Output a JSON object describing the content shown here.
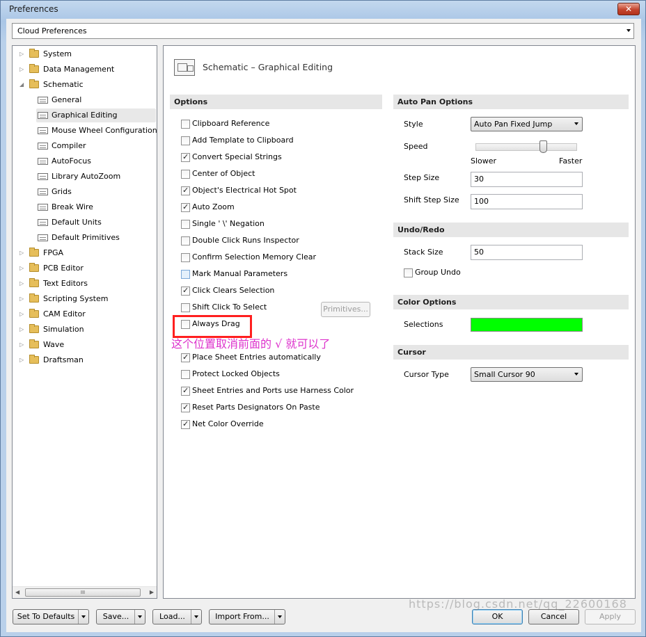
{
  "window": {
    "title": "Preferences",
    "close_label": "✕"
  },
  "category_select": {
    "value": "Cloud Preferences"
  },
  "tree": {
    "items": [
      {
        "label": "System",
        "level": 0,
        "kind": "folder",
        "expander": "closed"
      },
      {
        "label": "Data Management",
        "level": 0,
        "kind": "folder",
        "expander": "closed"
      },
      {
        "label": "Schematic",
        "level": 0,
        "kind": "folder-open",
        "expander": "open"
      },
      {
        "label": "General",
        "level": 1,
        "kind": "page"
      },
      {
        "label": "Graphical Editing",
        "level": 1,
        "kind": "page",
        "selected": true
      },
      {
        "label": "Mouse Wheel Configuration",
        "level": 1,
        "kind": "page"
      },
      {
        "label": "Compiler",
        "level": 1,
        "kind": "page"
      },
      {
        "label": "AutoFocus",
        "level": 1,
        "kind": "page"
      },
      {
        "label": "Library AutoZoom",
        "level": 1,
        "kind": "page"
      },
      {
        "label": "Grids",
        "level": 1,
        "kind": "page"
      },
      {
        "label": "Break Wire",
        "level": 1,
        "kind": "page"
      },
      {
        "label": "Default Units",
        "level": 1,
        "kind": "page"
      },
      {
        "label": "Default Primitives",
        "level": 1,
        "kind": "page"
      },
      {
        "label": "FPGA",
        "level": 0,
        "kind": "folder",
        "expander": "closed"
      },
      {
        "label": "PCB Editor",
        "level": 0,
        "kind": "folder",
        "expander": "closed"
      },
      {
        "label": "Text Editors",
        "level": 0,
        "kind": "folder",
        "expander": "closed"
      },
      {
        "label": "Scripting System",
        "level": 0,
        "kind": "folder",
        "expander": "closed"
      },
      {
        "label": "CAM Editor",
        "level": 0,
        "kind": "folder",
        "expander": "closed"
      },
      {
        "label": "Simulation",
        "level": 0,
        "kind": "folder",
        "expander": "closed"
      },
      {
        "label": "Wave",
        "level": 0,
        "kind": "folder",
        "expander": "closed"
      },
      {
        "label": "Draftsman",
        "level": 0,
        "kind": "folder",
        "expander": "closed"
      }
    ],
    "scroll_thumb_label": "III"
  },
  "panel": {
    "title": "Schematic – Graphical Editing"
  },
  "options": {
    "header": "Options",
    "items": [
      {
        "label": "Clipboard Reference",
        "checked": false
      },
      {
        "label": "Add Template to Clipboard",
        "checked": false
      },
      {
        "label": "Convert Special Strings",
        "checked": true
      },
      {
        "label": "Center of Object",
        "checked": false
      },
      {
        "label": "Object's Electrical Hot Spot",
        "checked": true
      },
      {
        "label": "Auto Zoom",
        "checked": true
      },
      {
        "label": "Single ' \\' Negation",
        "checked": false
      },
      {
        "label": "Double Click Runs Inspector",
        "checked": false
      },
      {
        "label": "Confirm Selection Memory Clear",
        "checked": false
      },
      {
        "label": "Mark Manual Parameters",
        "checked": false,
        "highlight": true
      },
      {
        "label": "Click Clears Selection",
        "checked": true
      },
      {
        "label": "Shift Click To Select",
        "checked": false
      },
      {
        "label": "Always Drag",
        "checked": false
      },
      {
        "label": "Place Sheet Entries automatically",
        "checked": true
      },
      {
        "label": "Protect Locked Objects",
        "checked": false
      },
      {
        "label": "Sheet Entries and Ports use Harness Color",
        "checked": true
      },
      {
        "label": "Reset Parts Designators On Paste",
        "checked": true
      },
      {
        "label": "Net Color Override",
        "checked": true
      }
    ],
    "primitives_button": "Primitives..."
  },
  "annotation": {
    "text": "这个位置取消前面的 √ 就可以了",
    "color": "#dd33cc",
    "box_color": "#ff1f1f"
  },
  "auto_pan": {
    "header": "Auto Pan Options",
    "style_label": "Style",
    "style_value": "Auto Pan Fixed Jump",
    "speed_label": "Speed",
    "speed_level": 0.68,
    "slower_label": "Slower",
    "faster_label": "Faster",
    "step_size_label": "Step Size",
    "step_size_value": "30",
    "shift_step_size_label": "Shift Step Size",
    "shift_step_size_value": "100"
  },
  "undo_redo": {
    "header": "Undo/Redo",
    "stack_size_label": "Stack Size",
    "stack_size_value": "50",
    "group_undo_label": "Group Undo",
    "group_undo_checked": false
  },
  "color_options": {
    "header": "Color Options",
    "selections_label": "Selections",
    "selections_color": "#00ff00"
  },
  "cursor": {
    "header": "Cursor",
    "cursor_type_label": "Cursor Type",
    "cursor_type_value": "Small Cursor 90"
  },
  "buttons": {
    "set_to_defaults": "Set To Defaults",
    "save": "Save...",
    "load": "Load...",
    "import_from": "Import From...",
    "ok": "OK",
    "cancel": "Cancel",
    "apply": "Apply"
  },
  "watermark": "https://blog.csdn.net/qq_22600168"
}
